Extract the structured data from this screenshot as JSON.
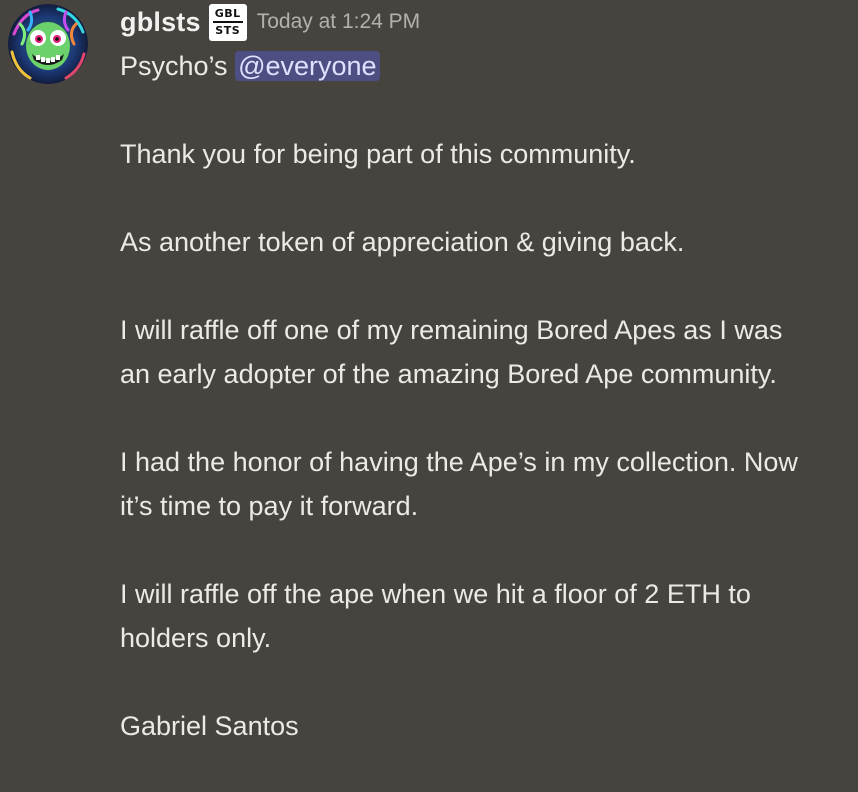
{
  "message": {
    "author": "gblsts",
    "server_tag": {
      "line1": "GBL",
      "line2": "STS"
    },
    "timestamp": "Today at 1:24 PM",
    "greeting": "Psycho’s",
    "mention": "@everyone",
    "paragraphs": [
      "Thank you for being part of this community.",
      "As another token of appreciation & giving back.",
      "I will raffle off one of my remaining Bored Apes as I was an early adopter of the amazing Bored Ape community.",
      "I had the honor of having the Ape’s in my collection. Now it’s time to pay it forward.",
      "I will raffle off the ape when we hit a floor of 2 ETH to holders only.",
      "Gabriel Santos"
    ]
  },
  "colors": {
    "background": "#47433f",
    "text": "#eceae7",
    "timestamp": "#b4b1ad",
    "mention_bg": "#4d4f82",
    "mention_text": "#dfe1ff"
  },
  "icons": {
    "avatar": "psychedelic-goblin-avatar-icon"
  }
}
